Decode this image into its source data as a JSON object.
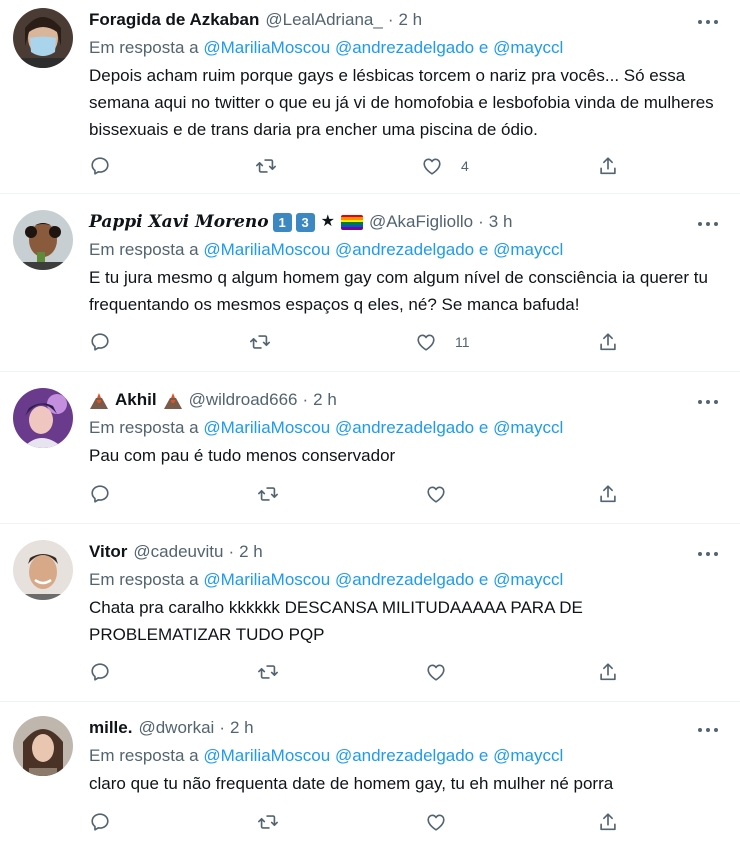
{
  "reply_prefix": "Em resposta a",
  "mentions": [
    "@MariliaMoscou",
    "@andrezadelgado",
    "e",
    "@mayccl"
  ],
  "tweets": [
    {
      "name": "Foragida de Azkaban",
      "handle": "@LealAdriana_",
      "dot": "·",
      "time": "2 h",
      "text": "Depois acham ruim porque gays e lésbicas torcem o nariz pra vocês... Só essa semana aqui no twitter o que eu já vi de homofobia e lesbofobia vinda de mulheres bissexuais e de trans daria pra encher uma piscina de ódio.",
      "likes": "4"
    },
    {
      "name": "Pappi Xavi Moreno",
      "badges": [
        "1",
        "3"
      ],
      "star": "★",
      "handle": "@AkaFigliollo",
      "dot": "·",
      "time": "3 h",
      "text": "E tu jura mesmo q algum homem gay com algum nível de consciência ia querer tu frequentando os mesmos espaços q eles, né? Se manca bafuda!",
      "likes": "11"
    },
    {
      "name": "Akhil",
      "handle": "@wildroad666",
      "dot": "·",
      "time": "2 h",
      "text": "Pau com pau é tudo menos conservador",
      "likes": ""
    },
    {
      "name": "Vitor",
      "handle": "@cadeuvitu",
      "dot": "·",
      "time": "2 h",
      "text": "Chata pra caralho kkkkkk DESCANSA MILITUDAAAAA PARA DE PROBLEMATIZAR TUDO PQP",
      "likes": ""
    },
    {
      "name": "mille.",
      "handle": "@dworkai",
      "dot": "·",
      "time": "2 h",
      "text": "claro que tu não frequenta date de homem gay, tu eh mulher né porra",
      "likes": ""
    }
  ],
  "icons": {
    "reply": "reply-icon",
    "retweet": "retweet-icon",
    "like": "heart-icon",
    "share": "share-icon",
    "more": "more-icon"
  },
  "colors": {
    "mention": "#1d9bf0",
    "secondary": "#536471",
    "text": "#0f1419",
    "divider": "#eff3f4"
  }
}
